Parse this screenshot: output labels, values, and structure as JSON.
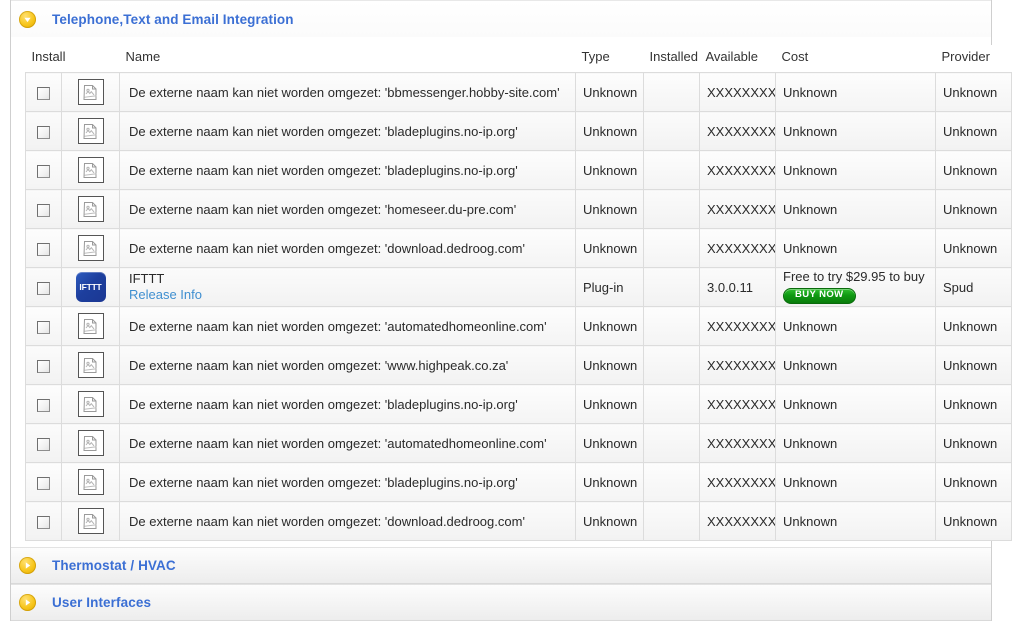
{
  "sections": [
    {
      "id": "telephone-text-email-integration",
      "title": "Telephone,Text and Email Integration",
      "state": "expanded",
      "icon": "triangle-down-icon"
    },
    {
      "id": "thermostat-hvac",
      "title": "Thermostat / HVAC",
      "state": "collapsed",
      "icon": "triangle-right-icon"
    },
    {
      "id": "user-interfaces",
      "title": "User Interfaces",
      "state": "collapsed",
      "icon": "triangle-right-icon"
    }
  ],
  "table": {
    "columns": [
      {
        "key": "install",
        "label": "Install"
      },
      {
        "key": "icon",
        "label": ""
      },
      {
        "key": "name",
        "label": "Name"
      },
      {
        "key": "type",
        "label": "Type"
      },
      {
        "key": "installed",
        "label": "Installed"
      },
      {
        "key": "available",
        "label": "Available"
      },
      {
        "key": "cost",
        "label": "Cost"
      },
      {
        "key": "provider",
        "label": "Provider"
      }
    ],
    "rows": [
      {
        "checked": false,
        "icon": "broken-image-icon",
        "name": "De externe naam kan niet worden omgezet: 'bbmessenger.hobby-site.com'",
        "type": "Unknown",
        "installed": "",
        "available": "XXXXXXXX",
        "cost": "Unknown",
        "provider": "Unknown"
      },
      {
        "checked": false,
        "icon": "broken-image-icon",
        "name": "De externe naam kan niet worden omgezet: 'bladeplugins.no-ip.org'",
        "type": "Unknown",
        "installed": "",
        "available": "XXXXXXXX",
        "cost": "Unknown",
        "provider": "Unknown"
      },
      {
        "checked": false,
        "icon": "broken-image-icon",
        "name": "De externe naam kan niet worden omgezet: 'bladeplugins.no-ip.org'",
        "type": "Unknown",
        "installed": "",
        "available": "XXXXXXXX",
        "cost": "Unknown",
        "provider": "Unknown"
      },
      {
        "checked": false,
        "icon": "broken-image-icon",
        "name": "De externe naam kan niet worden omgezet: 'homeseer.du-pre.com'",
        "type": "Unknown",
        "installed": "",
        "available": "XXXXXXXX",
        "cost": "Unknown",
        "provider": "Unknown"
      },
      {
        "checked": false,
        "icon": "broken-image-icon",
        "name": "De externe naam kan niet worden omgezet: 'download.dedroog.com'",
        "type": "Unknown",
        "installed": "",
        "available": "XXXXXXXX",
        "cost": "Unknown",
        "provider": "Unknown"
      },
      {
        "checked": false,
        "icon": "ifttt-logo-icon",
        "name": "IFTTT",
        "release_info_label": "Release Info",
        "type": "Plug-in",
        "installed": "",
        "available": "3.0.0.11",
        "cost": "Free to try $29.95 to buy",
        "buy_button_label": "BUY NOW",
        "provider": "Spud"
      },
      {
        "checked": false,
        "icon": "broken-image-icon",
        "name": "De externe naam kan niet worden omgezet: 'automatedhomeonline.com'",
        "type": "Unknown",
        "installed": "",
        "available": "XXXXXXXX",
        "cost": "Unknown",
        "provider": "Unknown"
      },
      {
        "checked": false,
        "icon": "broken-image-icon",
        "name": "De externe naam kan niet worden omgezet: 'www.highpeak.co.za'",
        "type": "Unknown",
        "installed": "",
        "available": "XXXXXXXX",
        "cost": "Unknown",
        "provider": "Unknown"
      },
      {
        "checked": false,
        "icon": "broken-image-icon",
        "name": "De externe naam kan niet worden omgezet: 'bladeplugins.no-ip.org'",
        "type": "Unknown",
        "installed": "",
        "available": "XXXXXXXX",
        "cost": "Unknown",
        "provider": "Unknown"
      },
      {
        "checked": false,
        "icon": "broken-image-icon",
        "name": "De externe naam kan niet worden omgezet: 'automatedhomeonline.com'",
        "type": "Unknown",
        "installed": "",
        "available": "XXXXXXXX",
        "cost": "Unknown",
        "provider": "Unknown"
      },
      {
        "checked": false,
        "icon": "broken-image-icon",
        "name": "De externe naam kan niet worden omgezet: 'bladeplugins.no-ip.org'",
        "type": "Unknown",
        "installed": "",
        "available": "XXXXXXXX",
        "cost": "Unknown",
        "provider": "Unknown"
      },
      {
        "checked": false,
        "icon": "broken-image-icon",
        "name": "De externe naam kan niet worden omgezet: 'download.dedroog.com'",
        "type": "Unknown",
        "installed": "",
        "available": "XXXXXXXX",
        "cost": "Unknown",
        "provider": "Unknown"
      }
    ]
  },
  "ifttt_logo_text": "IFTTT",
  "colors": {
    "section_title": "#3b6fd4",
    "link": "#3f8fd0",
    "accordion_icon": "#f7c51a",
    "buy_button": "#0f9a12",
    "ifttt_blue": "#1d3f9e"
  }
}
